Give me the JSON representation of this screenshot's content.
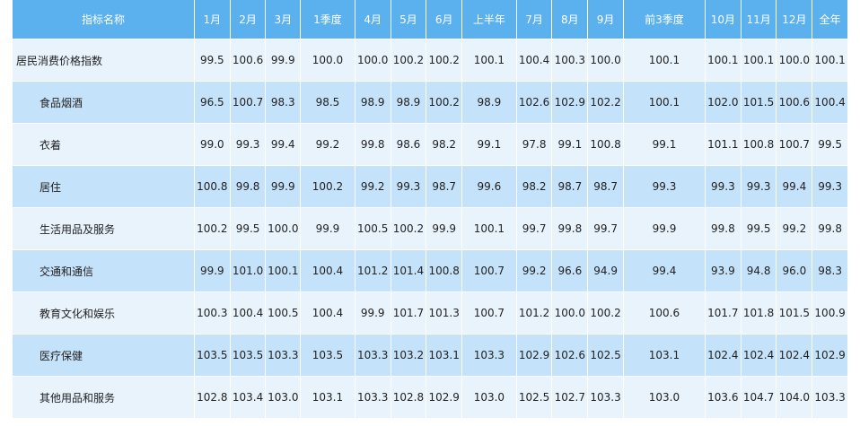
{
  "table": {
    "headers": [
      "指标名称",
      "1月",
      "2月",
      "3月",
      "1季度",
      "4月",
      "5月",
      "6月",
      "上半年",
      "7月",
      "8月",
      "9月",
      "前3季度",
      "10月",
      "11月",
      "12月",
      "全年"
    ],
    "rows": [
      {
        "name": "居民消费价格指数",
        "values": [
          "99.5",
          "100.6",
          "99.9",
          "100.0",
          "100.0",
          "100.2",
          "100.2",
          "100.1",
          "100.4",
          "100.3",
          "100.0",
          "100.1",
          "100.1",
          "100.1",
          "100.0",
          "100.1"
        ]
      },
      {
        "name": "食品烟酒",
        "values": [
          "96.5",
          "100.7",
          "98.3",
          "98.5",
          "98.9",
          "98.9",
          "100.2",
          "98.9",
          "102.6",
          "102.9",
          "102.2",
          "100.1",
          "102.0",
          "101.5",
          "100.6",
          "100.4"
        ]
      },
      {
        "name": "衣着",
        "values": [
          "99.0",
          "99.3",
          "99.4",
          "99.2",
          "99.8",
          "98.6",
          "98.2",
          "99.1",
          "97.8",
          "99.1",
          "100.8",
          "99.1",
          "101.1",
          "100.8",
          "100.7",
          "99.5"
        ]
      },
      {
        "name": "居住",
        "values": [
          "100.8",
          "99.8",
          "99.9",
          "100.2",
          "99.2",
          "99.3",
          "98.7",
          "99.6",
          "98.2",
          "98.7",
          "98.7",
          "99.3",
          "99.3",
          "99.3",
          "99.4",
          "99.3"
        ]
      },
      {
        "name": "生活用品及服务",
        "values": [
          "100.2",
          "99.5",
          "100.0",
          "99.9",
          "100.5",
          "100.2",
          "99.9",
          "100.1",
          "99.7",
          "99.8",
          "99.7",
          "99.9",
          "99.8",
          "99.5",
          "99.2",
          "99.8"
        ]
      },
      {
        "name": "交通和通信",
        "values": [
          "99.9",
          "101.0",
          "100.1",
          "100.4",
          "101.2",
          "101.4",
          "100.8",
          "100.7",
          "99.2",
          "96.6",
          "94.9",
          "99.4",
          "93.9",
          "94.8",
          "96.0",
          "98.3"
        ]
      },
      {
        "name": "教育文化和娱乐",
        "values": [
          "100.3",
          "100.4",
          "100.5",
          "100.4",
          "99.9",
          "101.7",
          "101.3",
          "100.7",
          "101.2",
          "100.0",
          "100.2",
          "100.6",
          "101.7",
          "101.8",
          "101.5",
          "100.9"
        ]
      },
      {
        "name": "医疗保健",
        "values": [
          "103.5",
          "103.5",
          "103.3",
          "103.5",
          "103.3",
          "103.2",
          "103.1",
          "103.3",
          "102.9",
          "102.6",
          "102.5",
          "103.1",
          "102.4",
          "102.4",
          "102.4",
          "102.9"
        ]
      },
      {
        "name": "其他用品和服务",
        "values": [
          "102.8",
          "103.4",
          "103.0",
          "103.1",
          "103.3",
          "102.8",
          "102.9",
          "103.0",
          "102.5",
          "102.7",
          "103.3",
          "103.0",
          "103.6",
          "104.7",
          "104.0",
          "103.3"
        ]
      }
    ]
  },
  "colors": {
    "header_bg": "#5bb0ee",
    "row_light": "#e8f3fc",
    "row_dark": "#c4e2fa"
  }
}
